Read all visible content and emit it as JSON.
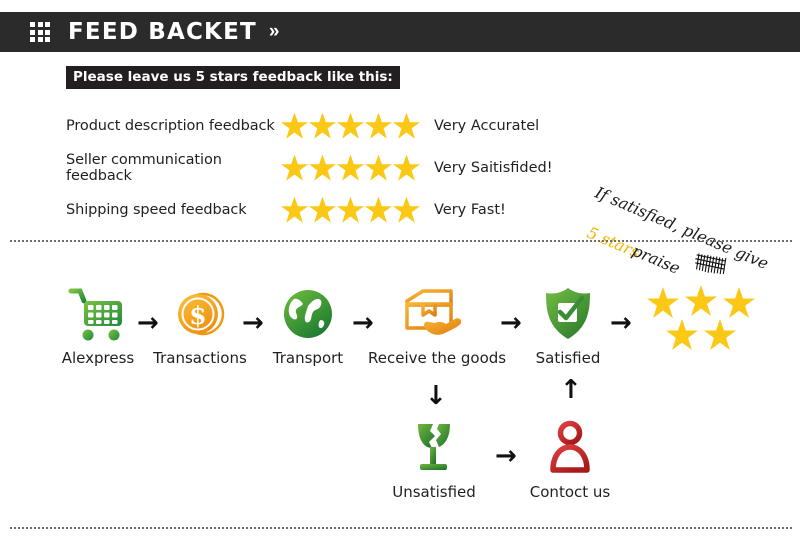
{
  "header": {
    "icon": "grid-icon",
    "title": "FEED BACKET",
    "chevrons": "»"
  },
  "feedback": {
    "title": "Please leave us 5 stars feedback like this:",
    "star_count": 5,
    "star_color": "#fcc816",
    "rows": [
      {
        "label": "Product description feedback",
        "stars": 5,
        "value": "Very Accuratel"
      },
      {
        "label": "Seller communication feedback",
        "stars": 5,
        "value": "Very Saitisfided!"
      },
      {
        "label": "Shipping speed feedback",
        "stars": 5,
        "value": "Very Fast!"
      }
    ],
    "handnote": {
      "line1": "If satisfied, please give",
      "line2": "5 stars",
      "line3": "praise",
      "highlight_color": "#f0b400"
    }
  },
  "flow": {
    "nodes": [
      {
        "label": "Alexpress",
        "icon": "shopping-cart-icon",
        "color": "#4caf27"
      },
      {
        "label": "Transactions",
        "icon": "coin-dollar-icon",
        "color": "#f4a415"
      },
      {
        "label": "Transport",
        "icon": "globe-icon",
        "color": "#3da537"
      },
      {
        "label": "Receive the goods",
        "icon": "package-hand-icon",
        "color": "#e8952a"
      },
      {
        "label": "Satisfied",
        "icon": "shield-check-icon",
        "color": "#46a03c"
      },
      {
        "label": "Unsatisfied",
        "icon": "broken-glass-icon",
        "color": "#3f9b36"
      },
      {
        "label": "Contoct us",
        "icon": "support-person-icon",
        "color": "#d12b2b"
      }
    ],
    "arrows": {
      "right": "→",
      "down": "↓",
      "up": "↑"
    },
    "result_stars": {
      "count": 5,
      "color": "#fcc816"
    }
  },
  "dividers": {
    "style": "dotted",
    "color": "#6e6e6e"
  }
}
